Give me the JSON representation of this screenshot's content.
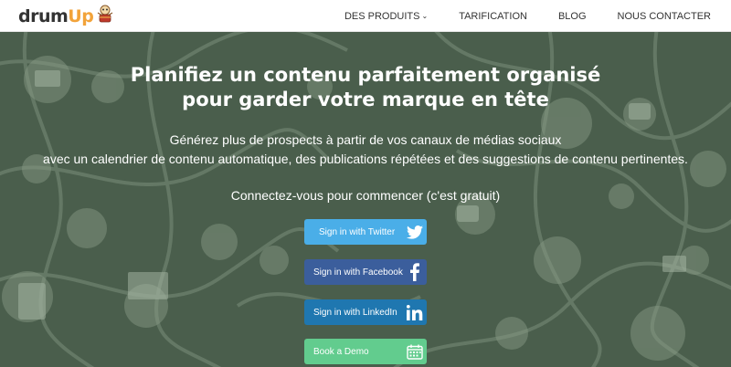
{
  "logo": {
    "text_main": "drum",
    "text_accent": "Up"
  },
  "nav": {
    "products": "DES PRODUITS",
    "pricing": "TARIFICATION",
    "blog": "BLOG",
    "contact": "NOUS CONTACTER"
  },
  "hero": {
    "title_line1": "Planifiez un contenu parfaitement organisé",
    "title_line2": "pour garder votre marque en tête",
    "subtitle_line1": "Générez plus de prospects à partir de vos canaux de médias sociaux",
    "subtitle_line2": "avec un calendrier de contenu automatique, des publications répétées et des suggestions de contenu pertinentes.",
    "cta_text": "Connectez-vous pour commencer (c'est gratuit)"
  },
  "buttons": {
    "twitter": "Sign in with Twitter",
    "facebook": "Sign in with Facebook",
    "linkedin": "Sign in with LinkedIn",
    "demo": "Book a Demo"
  },
  "colors": {
    "hero_bg": "#4a5e4c",
    "twitter": "#4aaee8",
    "facebook": "#3b5e9c",
    "linkedin": "#1f77b0",
    "demo": "#62cc8e",
    "logo_accent": "#f2a33a"
  },
  "icons": [
    "drumup-mascot-icon",
    "chevron-down-icon",
    "twitter-bird-icon",
    "facebook-f-icon",
    "linkedin-in-icon",
    "calendar-icon"
  ]
}
